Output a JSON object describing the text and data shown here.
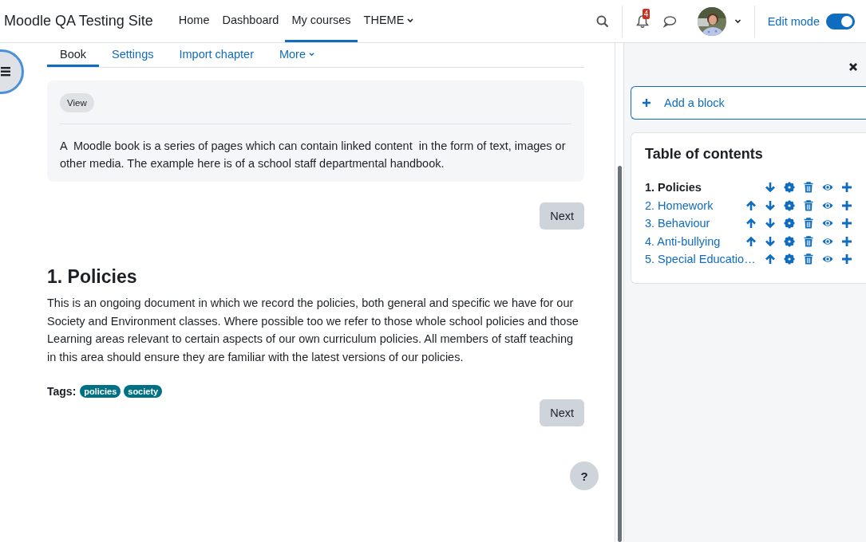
{
  "navbar": {
    "site_name": "Moodle QA Testing Site",
    "links": [
      {
        "label": "Home",
        "selected": false,
        "dropdown": false
      },
      {
        "label": "Dashboard",
        "selected": false,
        "dropdown": false
      },
      {
        "label": "My courses",
        "selected": true,
        "dropdown": false
      },
      {
        "label": "THEME",
        "selected": false,
        "dropdown": true
      }
    ],
    "notification_count": "4",
    "edit_mode": {
      "label": "Edit mode",
      "on": true
    }
  },
  "tabs": [
    {
      "label": "Book",
      "selected": true,
      "dropdown": false
    },
    {
      "label": "Settings",
      "selected": false,
      "dropdown": false
    },
    {
      "label": "Import chapter",
      "selected": false,
      "dropdown": false
    },
    {
      "label": "More",
      "selected": false,
      "dropdown": true
    }
  ],
  "intro": {
    "badge": "View",
    "text": "A  Moodle book is a series of pages which can contain linked content  in the form of text, images or other media. The example here is of a school staff departmental handbook."
  },
  "next_buttons": [
    "Next",
    "Next"
  ],
  "chapter": {
    "title": "1. Policies",
    "text": "This is an ongoing document in which we record the policies, both general and specific we have for our Society and Environment classes. Where possible too we refer to those whole school policies and those Learning areas relevant to certain aspects of our own curriculum policies. All members of staff teaching in this area should ensure they are familiar with the latest versions of our policies.",
    "tags_label": "Tags:",
    "tags": [
      "policies",
      "society"
    ]
  },
  "help_button": "?",
  "drawer": {
    "add_block": "Add a block",
    "toc": {
      "title": "Table of contents",
      "items": [
        {
          "label": "1. Policies",
          "selected": true,
          "actions": [
            {
              "kind": "down"
            },
            {
              "kind": "settings"
            },
            {
              "kind": "delete"
            },
            {
              "kind": "show"
            },
            {
              "kind": "add"
            }
          ]
        },
        {
          "label": "2. Homework",
          "selected": false,
          "actions": [
            {
              "kind": "up"
            },
            {
              "kind": "down"
            },
            {
              "kind": "settings"
            },
            {
              "kind": "delete"
            },
            {
              "kind": "show"
            },
            {
              "kind": "add"
            }
          ]
        },
        {
          "label": "3. Behaviour",
          "selected": false,
          "actions": [
            {
              "kind": "up"
            },
            {
              "kind": "down"
            },
            {
              "kind": "settings"
            },
            {
              "kind": "delete"
            },
            {
              "kind": "show"
            },
            {
              "kind": "add"
            }
          ]
        },
        {
          "label": "4. Anti-bullying",
          "selected": false,
          "actions": [
            {
              "kind": "up"
            },
            {
              "kind": "down"
            },
            {
              "kind": "settings"
            },
            {
              "kind": "delete"
            },
            {
              "kind": "show"
            },
            {
              "kind": "add"
            }
          ]
        },
        {
          "label": "5. Special Educatio…",
          "selected": false,
          "actions": [
            {
              "kind": "up"
            },
            {
              "kind": "settings"
            },
            {
              "kind": "delete"
            },
            {
              "kind": "show"
            },
            {
              "kind": "add"
            }
          ]
        }
      ]
    }
  }
}
